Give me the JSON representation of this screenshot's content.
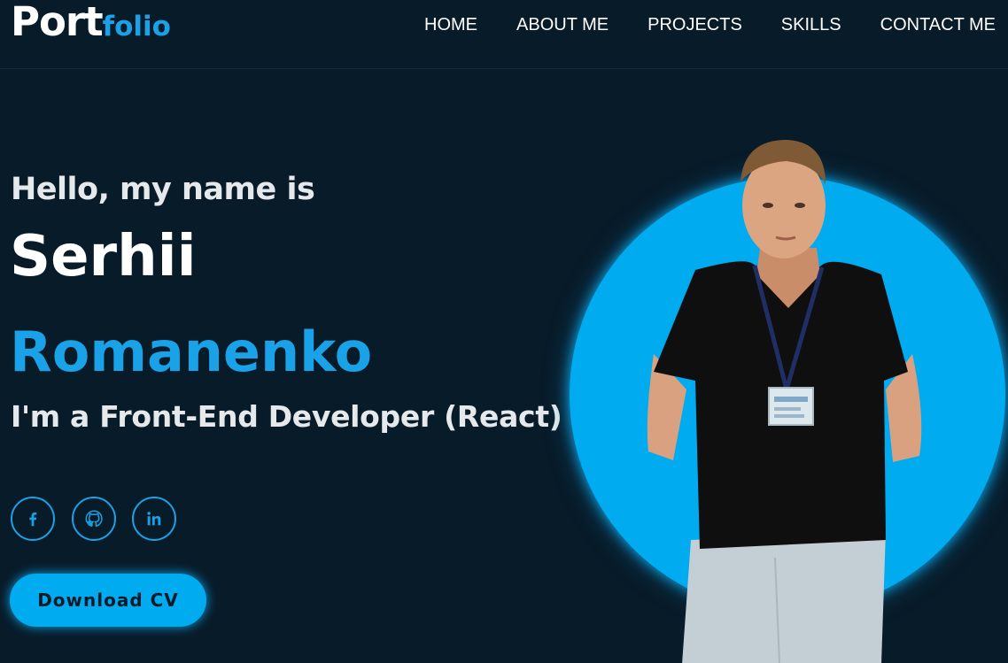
{
  "logo": {
    "part1": "Port",
    "part2": "folio"
  },
  "nav": {
    "items": [
      {
        "label": "HOME"
      },
      {
        "label": "ABOUT ME"
      },
      {
        "label": "PROJECTS"
      },
      {
        "label": "SKILLS"
      },
      {
        "label": "CONTACT ME"
      }
    ]
  },
  "hero": {
    "greeting": "Hello, my name is",
    "first_name": "Serhii",
    "last_name": "Romanenko",
    "role": "I'm a Front-End Developer (React)",
    "download_label": "Download CV"
  },
  "socials": [
    {
      "icon": "facebook-icon"
    },
    {
      "icon": "github-icon"
    },
    {
      "icon": "linkedin-icon"
    }
  ],
  "colors": {
    "background": "#081b29",
    "accent": "#00abf0",
    "text": "#ffffff"
  }
}
